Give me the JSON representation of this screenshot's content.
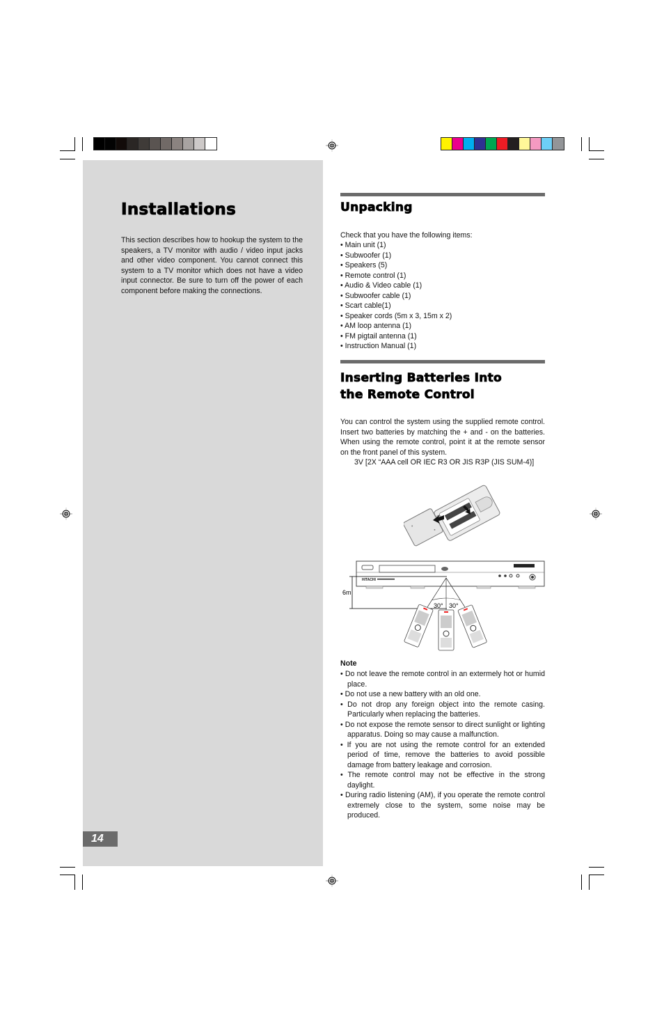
{
  "color_bars": {
    "grayscale": [
      "#000000",
      "#030303",
      "#120b09",
      "#2a2624",
      "#3f3b38",
      "#5a5451",
      "#716a67",
      "#8b8380",
      "#a8a3a1",
      "#cdc9c8",
      "#ffffff"
    ],
    "colors": [
      "#fff200",
      "#ec008c",
      "#00aeef",
      "#2e3192",
      "#00a651",
      "#ed1c24",
      "#231f20",
      "#fff799",
      "#f49ac1",
      "#6dcff6",
      "#939598"
    ]
  },
  "left": {
    "title": "Installations",
    "intro": "This section describes how to hookup the system to the speakers, a TV monitor with audio / video input jacks and other video component. You cannot connect this system to a TV monitor which does not have a video input connector. Be sure to turn off the power of each component before making the connections."
  },
  "unpacking": {
    "title": "Unpacking",
    "lead": "Check that you have the following items:",
    "items": [
      "• Main unit (1)",
      "• Subwoofer (1)",
      "• Speakers (5)",
      "• Remote control (1)",
      "• Audio & Video cable (1)",
      "• Subwoofer cable (1)",
      "• Scart cable(1)",
      "• Speaker cords (5m x 3, 15m x 2)",
      "• AM loop antenna (1)",
      "• FM pigtail antenna (1)",
      "• Instruction Manual (1)"
    ]
  },
  "batteries": {
    "title_line1": "Inserting Batteries Into",
    "title_line2": "the Remote Control",
    "body": "You can control the system using the supplied remote control. Insert two batteries by matching the + and - on the batteries. When using the remote control, point it at the remote sensor on the front panel of this system.",
    "spec": "3V [2X “AAA cell OR IEC R3 OR JIS R3P (JIS SUM-4)]",
    "diagram": {
      "distance_label": "6m",
      "angle_left": "30°",
      "angle_right": "30°",
      "brand": "HITACHI"
    }
  },
  "note": {
    "heading": "Note",
    "items": [
      "• Do not leave the remote control in an extermely hot or humid place.",
      "• Do not use a new battery with an old one.",
      "• Do not drop any foreign object into the remote casing. Particularly when replacing the batteries.",
      "• Do not expose the remote sensor to direct sunlight or lighting apparatus. Doing so may cause a malfunction.",
      "• If you are not using the remote control for an extended period of time, remove the batteries to avoid possible damage from battery leakage and corrosion.",
      "• The remote control may not be effective in the strong daylight.",
      "• During radio listening (AM), if you operate the remote control extremely close to the system, some noise may be produced."
    ]
  },
  "page_number": "14"
}
